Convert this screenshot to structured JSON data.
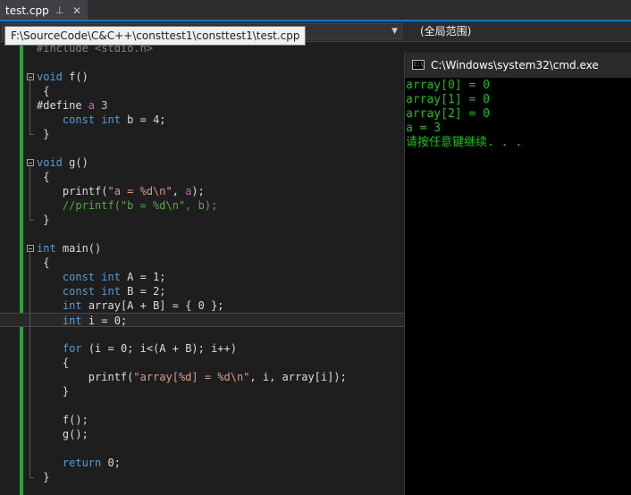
{
  "tab": {
    "title": "test.cpp",
    "pin_glyph": "⊥",
    "close_glyph": "✕"
  },
  "navbar": {
    "scope_label": "(全局范围)"
  },
  "tooltip": {
    "path": "F:\\SourceCode\\C&C++\\consttest1\\consttest1\\test.cpp"
  },
  "editor": {
    "lines": [
      {
        "t": "#include <stdio.h>",
        "c": "dim"
      },
      {
        "t": ""
      },
      {
        "t": "void f()",
        "kw": "void",
        "fold": true
      },
      {
        "t": " {"
      },
      {
        "t": "#define a 3"
      },
      {
        "t": "    const int b = 4;"
      },
      {
        "t": " }"
      },
      {
        "t": ""
      },
      {
        "t": "void g()",
        "fold": true
      },
      {
        "t": " {"
      },
      {
        "t": "    printf(\"a = %d\\n\", a);"
      },
      {
        "t": "    //printf(\"b = %d\\n\", b);"
      },
      {
        "t": " }"
      },
      {
        "t": ""
      },
      {
        "t": "int main()",
        "fold": true
      },
      {
        "t": " {"
      },
      {
        "t": "    const int A = 1;"
      },
      {
        "t": "    const int B = 2;"
      },
      {
        "t": "    int array[A + B] = { 0 };"
      },
      {
        "t": "    int i = 0;",
        "current": true
      },
      {
        "t": ""
      },
      {
        "t": "    for (i = 0; i<(A + B); i++)"
      },
      {
        "t": "    {"
      },
      {
        "t": "        printf(\"array[%d] = %d\\n\", i, array[i]);"
      },
      {
        "t": "    }"
      },
      {
        "t": ""
      },
      {
        "t": "    f();"
      },
      {
        "t": "    g();"
      },
      {
        "t": ""
      },
      {
        "t": "    return 0;"
      },
      {
        "t": " }"
      }
    ]
  },
  "cmd": {
    "title": "C:\\Windows\\system32\\cmd.exe",
    "icon_text": "C:\\",
    "output": [
      "array[0] = 0",
      "array[1] = 0",
      "array[2] = 0",
      "a = 3",
      "请按任意键继续. . ."
    ],
    "text_color": "#13c313",
    "background": "#000000"
  },
  "colors": {
    "accent": "#007acc",
    "change_bar": "#2ea043",
    "keyword": "#569cd6",
    "string": "#d69d85",
    "comment": "#57a64a",
    "macro": "#bd63c5"
  }
}
